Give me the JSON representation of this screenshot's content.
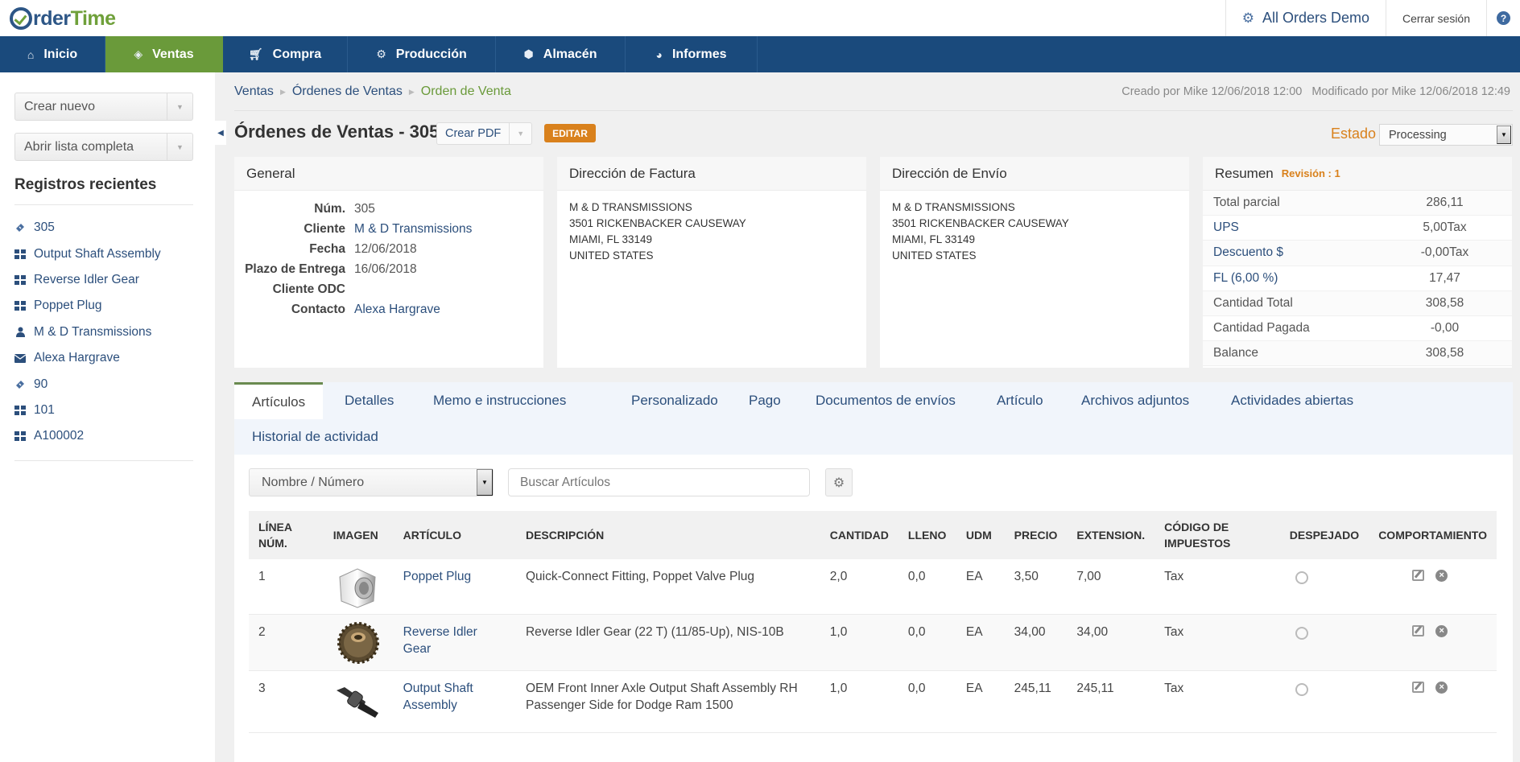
{
  "app": {
    "logo_part1": "rder",
    "logo_part2": "Time",
    "account_name": "All Orders Demo",
    "logout_label": "Cerrar sesión",
    "help_glyph": "?"
  },
  "nav": {
    "items": [
      {
        "label": "Inicio",
        "icon": "home-icon",
        "active": false
      },
      {
        "label": "Ventas",
        "icon": "ticket-icon",
        "active": true
      },
      {
        "label": "Compra",
        "icon": "cart-icon",
        "active": false
      },
      {
        "label": "Producción",
        "icon": "gears-icon",
        "active": false
      },
      {
        "label": "Almacén",
        "icon": "cube-icon",
        "active": false
      },
      {
        "label": "Informes",
        "icon": "pie-chart-icon",
        "active": false
      }
    ]
  },
  "sidebar": {
    "create_new": "Crear nuevo",
    "open_full_list": "Abrir lista completa",
    "recent_title": "Registros recientes",
    "recent": [
      {
        "label": "305",
        "icon": "ticket-icon"
      },
      {
        "label": "Output Shaft Assembly",
        "icon": "grid-icon"
      },
      {
        "label": "Reverse Idler Gear",
        "icon": "grid-icon"
      },
      {
        "label": "Poppet Plug",
        "icon": "grid-icon"
      },
      {
        "label": "M & D Transmissions",
        "icon": "user-icon"
      },
      {
        "label": "Alexa Hargrave",
        "icon": "envelope-icon"
      },
      {
        "label": "90",
        "icon": "ticket-icon"
      },
      {
        "label": "101",
        "icon": "grid-icon"
      },
      {
        "label": "A100002",
        "icon": "grid-icon"
      }
    ]
  },
  "breadcrumb": [
    "Ventas",
    "Órdenes de Ventas",
    "Orden de Venta"
  ],
  "audit": {
    "created": "Creado por Mike 12/06/2018 12:00",
    "modified": "Modificado por Mike 12/06/2018 12:49"
  },
  "header": {
    "title": "Órdenes de Ventas - 305",
    "pdf_label": "Crear PDF",
    "edit_label": "EDITAR",
    "status_label": "Estado",
    "status_value": "Processing"
  },
  "general": {
    "title": "General",
    "rows": [
      {
        "label": "Núm.",
        "value": "305",
        "link": false
      },
      {
        "label": "Cliente",
        "value": "M & D Transmissions",
        "link": true
      },
      {
        "label": "Fecha",
        "value": "12/06/2018",
        "link": false
      },
      {
        "label": "Plazo de Entrega",
        "value": "16/06/2018",
        "link": false
      },
      {
        "label": "Cliente ODC",
        "value": "",
        "link": false
      },
      {
        "label": "Contacto",
        "value": "Alexa Hargrave",
        "link": true
      }
    ]
  },
  "billing": {
    "title": "Dirección de Factura",
    "lines": [
      "M & D TRANSMISSIONS",
      "3501 RICKENBACKER CAUSEWAY",
      "MIAMI, FL 33149",
      "UNITED STATES"
    ]
  },
  "shipping": {
    "title": "Dirección de Envío",
    "lines": [
      "M & D TRANSMISSIONS",
      "3501 RICKENBACKER CAUSEWAY",
      "MIAMI, FL 33149",
      "UNITED STATES"
    ]
  },
  "summary": {
    "title": "Resumen",
    "revision": "Revisión : 1",
    "rows": [
      {
        "label": "Total parcial",
        "value": "286,11",
        "link": false
      },
      {
        "label": "UPS",
        "value": "5,00Tax",
        "link": true
      },
      {
        "label": "Descuento $",
        "value": "-0,00Tax",
        "link": true
      },
      {
        "label": "FL (6,00 %)",
        "value": "17,47",
        "link": true
      },
      {
        "label": "Cantidad Total",
        "value": "308,58",
        "link": false
      },
      {
        "label": "Cantidad Pagada",
        "value": "-0,00",
        "link": false
      },
      {
        "label": "Balance",
        "value": "308,58",
        "link": false
      }
    ]
  },
  "tabs": [
    {
      "label": "Artículos",
      "active": true
    },
    {
      "label": "Detalles"
    },
    {
      "label": "Memo e instrucciones"
    },
    {
      "label": "Personalizado"
    },
    {
      "label": "Pago"
    },
    {
      "label": "Documentos de envíos"
    },
    {
      "label": "Artículo"
    },
    {
      "label": "Archivos adjuntos"
    },
    {
      "label": "Actividades abiertas"
    },
    {
      "label": "Historial de actividad"
    }
  ],
  "filters": {
    "field_select": "Nombre / Número",
    "search_placeholder": "Buscar Artículos"
  },
  "table": {
    "headers": {
      "line": "LÍNEA NÚM.",
      "image": "IMAGEN",
      "item": "ARTÍCULO",
      "description": "DESCRIPCIÓN",
      "qty": "CANTIDAD",
      "filled": "LLENO",
      "uom": "UDM",
      "price": "PRECIO",
      "extension": "EXTENSION.",
      "tax_code": "CÓDIGO DE IMPUESTOS",
      "cleared": "DESPEJADO",
      "actions": "COMPORTAMIENTO"
    },
    "rows": [
      {
        "line": "1",
        "item": "Poppet Plug",
        "description": "Quick-Connect Fitting, Poppet Valve Plug",
        "qty": "2,0",
        "filled": "0,0",
        "uom": "EA",
        "price": "3,50",
        "extension": "7,00",
        "tax_code": "Tax",
        "image": "poppet-plug-image"
      },
      {
        "line": "2",
        "item": "Reverse Idler Gear",
        "description": "Reverse Idler Gear (22 T) (11/85-Up), NIS-10B",
        "qty": "1,0",
        "filled": "0,0",
        "uom": "EA",
        "price": "34,00",
        "extension": "34,00",
        "tax_code": "Tax",
        "image": "idler-gear-image"
      },
      {
        "line": "3",
        "item": "Output Shaft Assembly",
        "description": "OEM Front Inner Axle Output Shaft Assembly RH Passenger Side for Dodge Ram 1500",
        "qty": "1,0",
        "filled": "0,0",
        "uom": "EA",
        "price": "245,11",
        "extension": "245,11",
        "tax_code": "Tax",
        "image": "output-shaft-image"
      }
    ]
  },
  "colors": {
    "nav_bg": "#1a4a7c",
    "nav_active": "#6a9a3a",
    "accent_orange": "#d9811c",
    "link": "#2c4f7c"
  }
}
